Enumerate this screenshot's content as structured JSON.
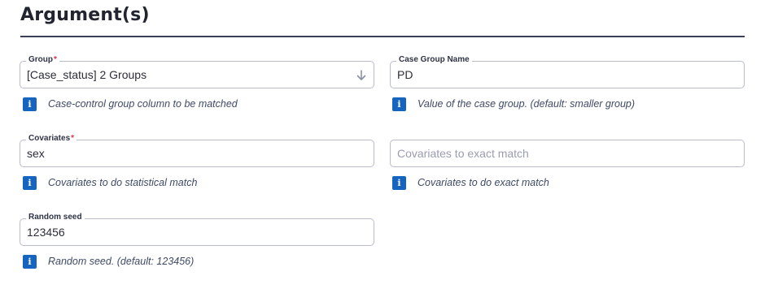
{
  "section": {
    "title": "Argument(s)"
  },
  "fields": {
    "group": {
      "label": "Group",
      "required_mark": "*",
      "value": "[Case_status] 2 Groups",
      "hint": "Case-control group column to be matched",
      "icon": "info-icon"
    },
    "case_group_name": {
      "label": "Case Group Name",
      "value": "PD",
      "hint": "Value of the case group. (default: smaller group)",
      "icon": "info-icon"
    },
    "covariates": {
      "label": "Covariates",
      "required_mark": "*",
      "value": "sex",
      "hint": "Covariates to do statistical match",
      "icon": "info-icon"
    },
    "exact_match": {
      "placeholder": "Covariates to exact match",
      "hint": "Covariates to do exact match",
      "icon": "info-icon"
    },
    "random_seed": {
      "label": "Random seed",
      "value": "123456",
      "hint": "Random seed. (default: 123456)",
      "icon": "info-icon"
    }
  },
  "info_glyph": "i",
  "colors": {
    "accent": "#1565c0",
    "required": "#e0304a",
    "border": "#b9bccc",
    "hint_text": "#3f4a66"
  }
}
